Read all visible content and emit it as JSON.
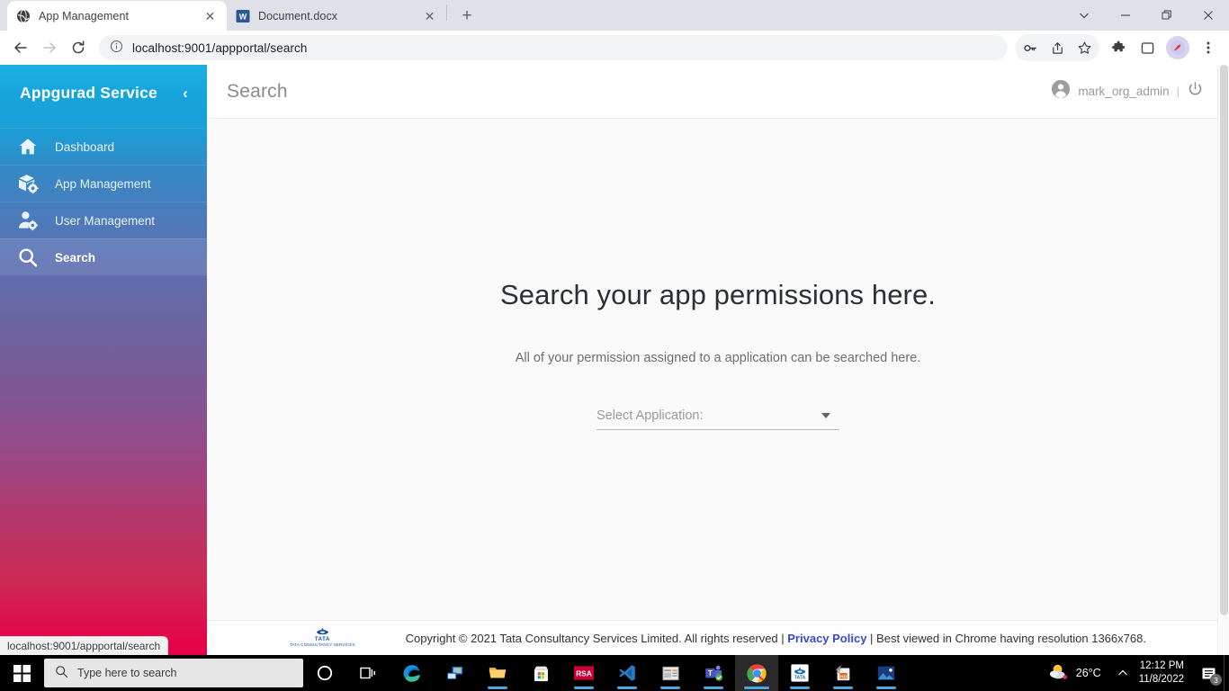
{
  "browser": {
    "tabs": [
      {
        "title": "App Management",
        "favicon": "globe-icon",
        "active": true
      },
      {
        "title": "Document.docx",
        "favicon": "word-icon",
        "active": false
      }
    ],
    "new_tab_label": "+",
    "window_controls": {
      "tab_search": "tab-search-icon",
      "minimize": "minimize-icon",
      "maximize": "restore-icon",
      "close": "close-icon"
    },
    "toolbar": {
      "back": "back-arrow-icon",
      "forward": "forward-arrow-icon",
      "reload": "reload-icon",
      "site_info": "info-circle-icon",
      "url": "localhost:9001/appportal/search",
      "password_key": "key-icon",
      "share": "share-icon",
      "bookmark": "star-icon",
      "extensions": "puzzle-icon",
      "side_panel": "side-panel-icon",
      "profile": "profile-avatar-icon",
      "menu": "three-dot-menu-icon"
    },
    "status_bar": "localhost:9001/appportal/search"
  },
  "sidebar": {
    "brand": "Appgurad Service",
    "collapse_icon": "chevron-left-icon",
    "items": [
      {
        "label": "Dashboard",
        "icon": "home-icon",
        "active": false
      },
      {
        "label": "App Management",
        "icon": "box-gear-icon",
        "active": false
      },
      {
        "label": "User Management",
        "icon": "user-gear-icon",
        "active": false
      },
      {
        "label": "Search",
        "icon": "search-icon",
        "active": true
      }
    ],
    "gradient_top": "#1eb0e2",
    "gradient_bottom": "#e80044"
  },
  "header": {
    "title": "Search",
    "user": "mark_org_admin",
    "user_icon": "account-circle-icon",
    "separator": "|",
    "logout_icon": "power-icon"
  },
  "main": {
    "headline": "Search your app permissions here.",
    "subline": "All of your permission assigned to a application can be searched here.",
    "select": {
      "label": "Select Application:",
      "value": "",
      "arrow_icon": "chevron-down-icon"
    }
  },
  "footer": {
    "logo_alt": "tata-consultancy-services-logo",
    "logo_word": "TATA",
    "logo_sub": "TATA CONSULTANCY SERVICES",
    "copyright_pre": "Copyright © 2021 Tata Consultancy Services Limited. All rights reserved | ",
    "privacy_link": "Privacy Policy",
    "copyright_post": " | Best viewed in Chrome having resolution 1366x768."
  },
  "taskbar": {
    "start_icon": "windows-start-icon",
    "search_placeholder": "Type here to search",
    "search_icon": "search-icon",
    "icons": [
      {
        "name": "cortana-icon"
      },
      {
        "name": "task-view-icon"
      },
      {
        "name": "microsoft-edge-icon"
      },
      {
        "name": "remote-desktop-icon"
      },
      {
        "name": "file-explorer-icon"
      },
      {
        "name": "microsoft-store-icon"
      },
      {
        "name": "rsa-securid-icon"
      },
      {
        "name": "visual-studio-code-icon"
      },
      {
        "name": "app-window-icon"
      },
      {
        "name": "microsoft-teams-icon"
      },
      {
        "name": "google-chrome-icon"
      },
      {
        "name": "tata-app-icon"
      },
      {
        "name": "archive-app-icon"
      },
      {
        "name": "photos-icon"
      }
    ],
    "tray": {
      "weather_temp": "26°C",
      "weather_icon": "partly-cloudy-icon",
      "overflow_icon": "chevron-up-icon",
      "time": "12:12 PM",
      "date": "11/8/2022",
      "notification_icon": "notification-icon",
      "notification_count": "3"
    }
  }
}
